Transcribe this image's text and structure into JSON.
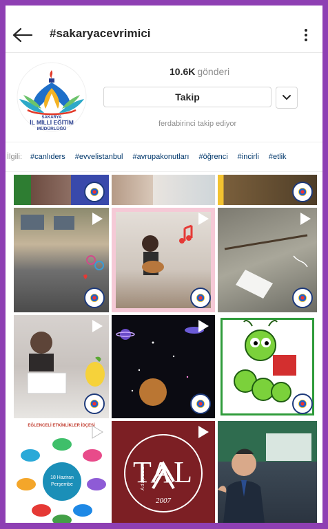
{
  "header": {
    "title": "#sakaryacevrimici",
    "back_icon": "arrow-left-icon",
    "more_icon": "more-vertical-icon"
  },
  "profile": {
    "posts_count": "10.6K",
    "posts_label": "gönderi",
    "follow_label": "Takip",
    "following_note": "ferdabirinci takip ediyor",
    "logo": {
      "line1": "SAKARYA",
      "line2": "İL MİLLİ EĞİTİM",
      "line3": "MÜDÜRLÜĞÜ"
    }
  },
  "related": {
    "prefix": "İlgili:",
    "tags": [
      "#canlıders",
      "#evvelistanbul",
      "#avrupakonutları",
      "#öğrenci",
      "#incirli",
      "#etlik"
    ]
  },
  "grid": {
    "tal_text": "TAL",
    "tal_side": "Adapazarı",
    "tal_year": "2007",
    "events_caption": "EĞLENCELİ ETKİNLİKLER İDÇESİ",
    "events_center": "18 Haziran Perşembe"
  },
  "colors": {
    "frame": "#8e3fb3",
    "link": "#00376b",
    "muted": "#8e8e8e",
    "text": "#262626"
  }
}
